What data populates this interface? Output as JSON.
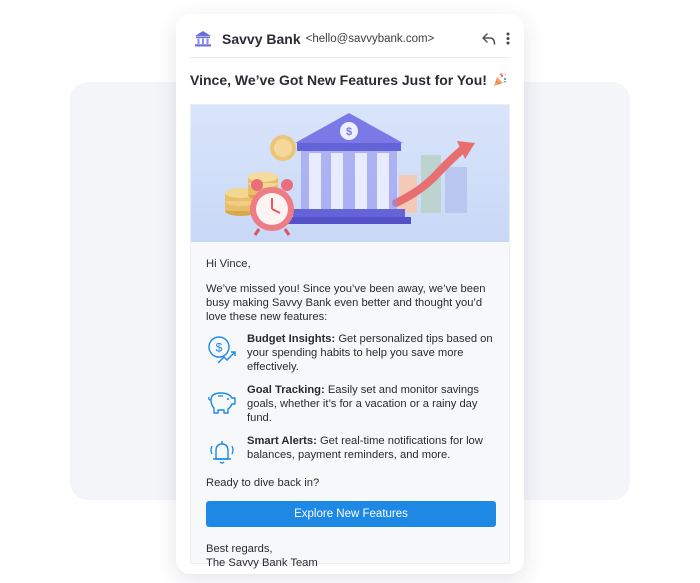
{
  "colors": {
    "accent": "#1e88e5",
    "icon_blue": "#1e88e5",
    "bank_purple": "#6c6ce0",
    "hero_bg": "#d3e0f9"
  },
  "header": {
    "sender_name": "Savvy Bank",
    "sender_email": "<hello@savvybank.com>",
    "icons": [
      "bank-icon",
      "reply-icon",
      "kebab-menu-icon"
    ]
  },
  "subject": {
    "text": "Vince, We’ve Got New Features Just for You!",
    "icon": "party-popper-icon"
  },
  "body": {
    "greeting": "Hi Vince,",
    "intro": "We’ve missed you! Since you’ve been away, we’ve been busy making Savvy Bank even better and thought you’d love these new features:",
    "features": [
      {
        "title": "Budget Insights:",
        "description": " Get personalized tips based on your spending habits to help you save more effectively.",
        "icon": "money-growth-icon"
      },
      {
        "title": "Goal Tracking:",
        "description": " Easily set and monitor savings goals, whether it’s for a vacation or a rainy day fund.",
        "icon": "piggy-bank-icon"
      },
      {
        "title": "Smart Alerts:",
        "description": " Get real-time notifications for low balances, payment reminders, and more.",
        "icon": "bell-alert-icon"
      }
    ],
    "question": "Ready to dive back in?",
    "cta_label": "Explore New Features",
    "signoff_line1": "Best regards,",
    "signoff_line2": "The Savvy Bank Team"
  }
}
